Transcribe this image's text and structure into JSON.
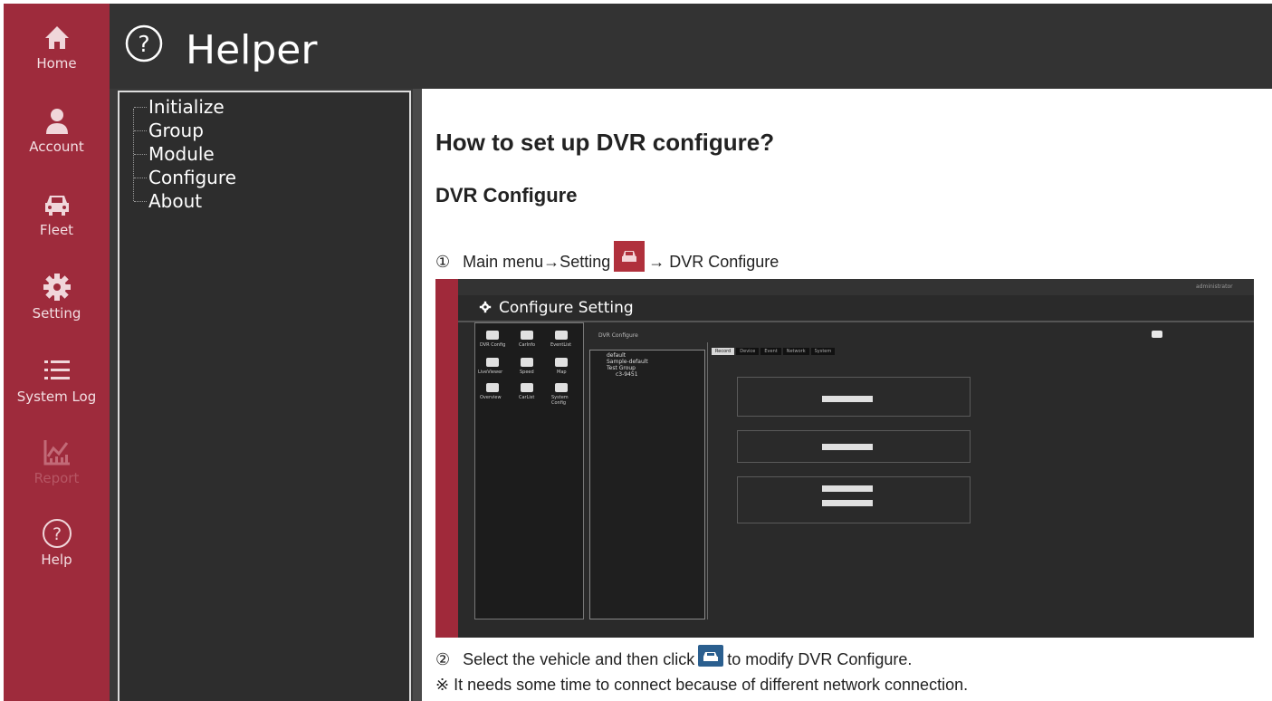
{
  "sidebar": {
    "items": [
      {
        "label": "Home",
        "icon": "home-icon"
      },
      {
        "label": "Account",
        "icon": "account-icon"
      },
      {
        "label": "Fleet",
        "icon": "car-icon"
      },
      {
        "label": "Setting",
        "icon": "gear-icon"
      },
      {
        "label": "System Log",
        "icon": "list-icon"
      },
      {
        "label": "Report",
        "icon": "chart-icon"
      },
      {
        "label": "Help",
        "icon": "question-icon"
      }
    ]
  },
  "header": {
    "title": "Helper"
  },
  "tree": {
    "items": [
      "Initialize",
      "Group",
      "Module",
      "Configure",
      "About"
    ]
  },
  "content": {
    "heading": "How to set up DVR configure?",
    "subheading": "DVR Configure",
    "step1": {
      "num": "①",
      "text_before": "Main menu→Setting",
      "text_after": "→ DVR Configure"
    },
    "step2": {
      "num": "②",
      "text_before": "Select the vehicle and then click",
      "text_after": "to modify DVR Configure."
    },
    "note": "※  It needs some time to connect because of different network connection."
  },
  "screenshot": {
    "title": "Configure Setting",
    "panel_title": "DVR Configure",
    "user": "administrator",
    "icons": [
      {
        "label": "DVR Config"
      },
      {
        "label": "CarInfo"
      },
      {
        "label": "EventList"
      },
      {
        "label": "LiveViewer"
      },
      {
        "label": "Speed"
      },
      {
        "label": "Map"
      },
      {
        "label": "Overview"
      },
      {
        "label": "CarList"
      },
      {
        "label": "System Config"
      }
    ],
    "tree": [
      "default",
      "Sample-default",
      "Test Group",
      "c3-9451"
    ],
    "tabs": [
      "Record",
      "Device",
      "Event",
      "Network",
      "System"
    ]
  },
  "colors": {
    "sidebar": "#9e2b3c",
    "header": "#333333",
    "tree_bg": "#2d2d2d"
  }
}
